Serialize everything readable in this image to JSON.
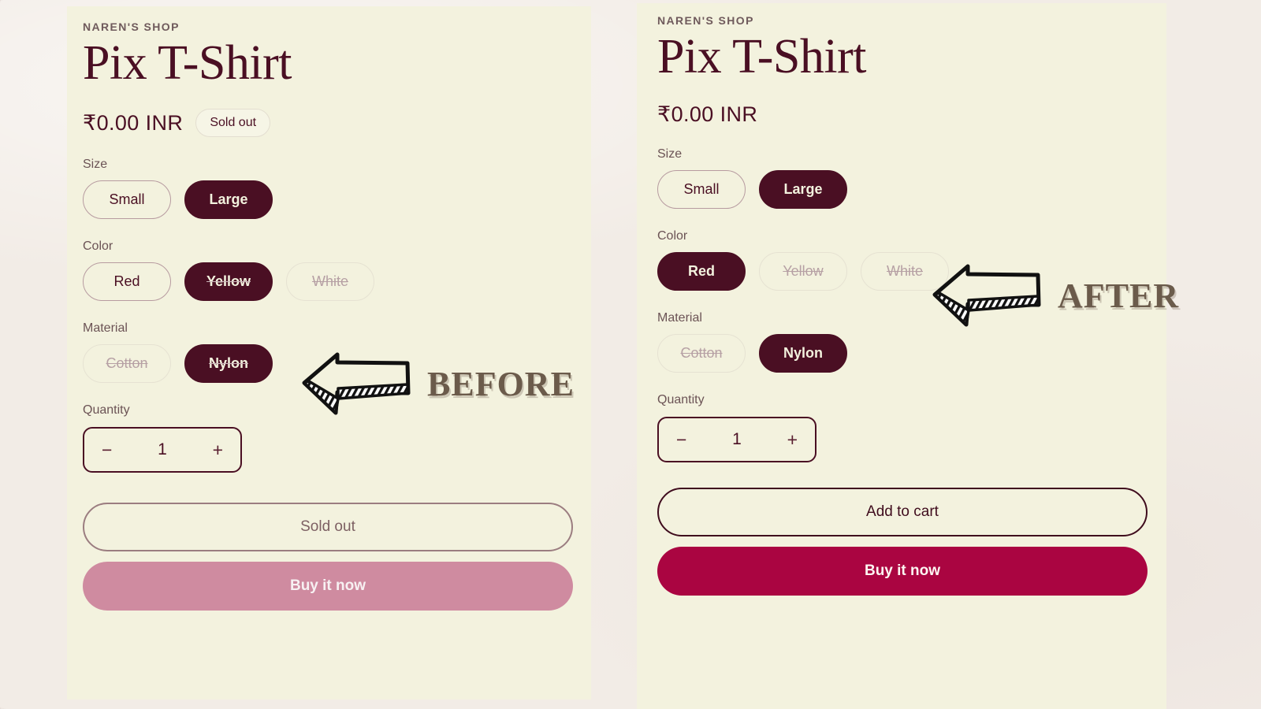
{
  "colors": {
    "page_background": "#f2ece6",
    "panel_background": "#f3f2de",
    "brand_maroon": "#4a0f23",
    "muted_text": "#6b5355",
    "buy_now_disabled": "#cf8ba0",
    "buy_now_active": "#aa0541",
    "annotation_text": "#6b5b4b"
  },
  "before": {
    "vendor": "NAREN'S SHOP",
    "title": "Pix T-Shirt",
    "price": "₹0.00 INR",
    "availability_badge": "Sold out",
    "options": [
      {
        "label": "Size",
        "values": [
          {
            "label": "Small",
            "selected": false,
            "struck": false,
            "disabled": false
          },
          {
            "label": "Large",
            "selected": true,
            "struck": false,
            "disabled": false
          }
        ]
      },
      {
        "label": "Color",
        "values": [
          {
            "label": "Red",
            "selected": false,
            "struck": false,
            "disabled": false
          },
          {
            "label": "Yellow",
            "selected": true,
            "struck": true,
            "disabled": false
          },
          {
            "label": "White",
            "selected": false,
            "struck": true,
            "disabled": true
          }
        ]
      },
      {
        "label": "Material",
        "values": [
          {
            "label": "Cotton",
            "selected": false,
            "struck": true,
            "disabled": true
          },
          {
            "label": "Nylon",
            "selected": true,
            "struck": true,
            "disabled": false
          }
        ]
      }
    ],
    "quantity": {
      "label": "Quantity",
      "decrease_icon": "minus-icon",
      "value": "1",
      "increase_icon": "plus-icon"
    },
    "add_to_cart_label": "Sold out",
    "add_to_cart_enabled": false,
    "buy_now_label": "Buy it now",
    "buy_now_enabled": false
  },
  "after": {
    "vendor": "NAREN'S SHOP",
    "title": "Pix T-Shirt",
    "price": "₹0.00 INR",
    "availability_badge": null,
    "options": [
      {
        "label": "Size",
        "values": [
          {
            "label": "Small",
            "selected": false,
            "struck": false,
            "disabled": false
          },
          {
            "label": "Large",
            "selected": true,
            "struck": false,
            "disabled": false
          }
        ]
      },
      {
        "label": "Color",
        "values": [
          {
            "label": "Red",
            "selected": true,
            "struck": false,
            "disabled": false
          },
          {
            "label": "Yellow",
            "selected": false,
            "struck": true,
            "disabled": true
          },
          {
            "label": "White",
            "selected": false,
            "struck": true,
            "disabled": true
          }
        ]
      },
      {
        "label": "Material",
        "values": [
          {
            "label": "Cotton",
            "selected": false,
            "struck": true,
            "disabled": true
          },
          {
            "label": "Nylon",
            "selected": true,
            "struck": false,
            "disabled": false
          }
        ]
      }
    ],
    "quantity": {
      "label": "Quantity",
      "decrease_icon": "minus-icon",
      "value": "1",
      "increase_icon": "plus-icon"
    },
    "add_to_cart_label": "Add to cart",
    "add_to_cart_enabled": true,
    "buy_now_label": "Buy it now",
    "buy_now_enabled": true
  },
  "annotations": [
    {
      "icon": "arrow-left-hand-drawn-icon",
      "text": "BEFORE"
    },
    {
      "icon": "arrow-left-hand-drawn-icon",
      "text": "AFTER"
    }
  ]
}
